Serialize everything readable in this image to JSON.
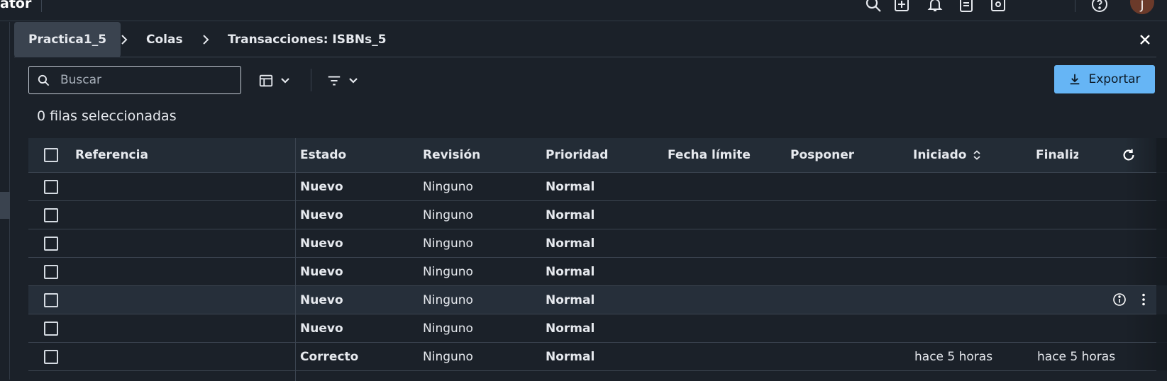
{
  "topbar": {
    "app_title_fragment": "ator",
    "icons": [
      "search-icon",
      "add-box-icon",
      "bell-icon",
      "clipboard-icon",
      "settings-icon",
      "help-icon"
    ],
    "avatar_initial": "J"
  },
  "breadcrumb": {
    "items": [
      "Practica1_5",
      "Colas",
      "Transacciones: ISBNs_5"
    ]
  },
  "toolbar": {
    "search_placeholder": "Buscar",
    "export_label": "Exportar"
  },
  "selection": {
    "count_text": "0 filas seleccionadas"
  },
  "table": {
    "columns": [
      "Referencia",
      "Estado",
      "Revisión",
      "Prioridad",
      "Fecha límite",
      "Posponer",
      "Iniciado",
      "Finaliz"
    ],
    "rows": [
      {
        "referencia": "",
        "estado": "Nuevo",
        "revision": "Ninguno",
        "prioridad": "Normal",
        "fecha_limite": "",
        "posponer": "",
        "iniciado": "",
        "finalizado": ""
      },
      {
        "referencia": "",
        "estado": "Nuevo",
        "revision": "Ninguno",
        "prioridad": "Normal",
        "fecha_limite": "",
        "posponer": "",
        "iniciado": "",
        "finalizado": ""
      },
      {
        "referencia": "",
        "estado": "Nuevo",
        "revision": "Ninguno",
        "prioridad": "Normal",
        "fecha_limite": "",
        "posponer": "",
        "iniciado": "",
        "finalizado": ""
      },
      {
        "referencia": "",
        "estado": "Nuevo",
        "revision": "Ninguno",
        "prioridad": "Normal",
        "fecha_limite": "",
        "posponer": "",
        "iniciado": "",
        "finalizado": ""
      },
      {
        "referencia": "",
        "estado": "Nuevo",
        "revision": "Ninguno",
        "prioridad": "Normal",
        "fecha_limite": "",
        "posponer": "",
        "iniciado": "",
        "finalizado": ""
      },
      {
        "referencia": "",
        "estado": "Nuevo",
        "revision": "Ninguno",
        "prioridad": "Normal",
        "fecha_limite": "",
        "posponer": "",
        "iniciado": "",
        "finalizado": ""
      },
      {
        "referencia": "",
        "estado": "Correcto",
        "revision": "Ninguno",
        "prioridad": "Normal",
        "fecha_limite": "",
        "posponer": "",
        "iniciado": "hace 5 horas",
        "finalizado": "hace 5 horas"
      }
    ]
  },
  "colors": {
    "background": "#1b2129",
    "header_bg": "#232c36",
    "accent_button": "#66b5f5",
    "active_crumb": "#3a434f",
    "avatar": "#6b3a2a"
  }
}
